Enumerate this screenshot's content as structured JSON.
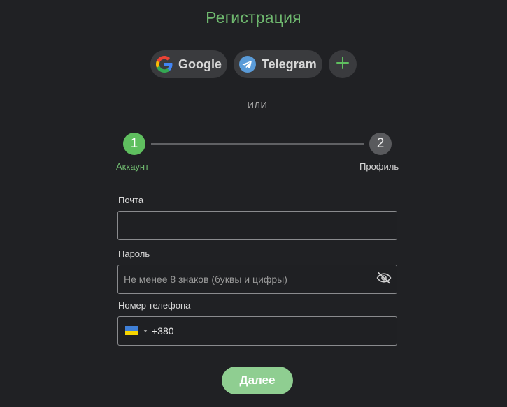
{
  "page": {
    "title": "Регистрация",
    "accent_color": "#6fb96f"
  },
  "social": {
    "google_label": "Google",
    "telegram_label": "Telegram",
    "google_icon": "google-logo-icon",
    "telegram_icon": "telegram-logo-icon",
    "more_icon": "plus-icon"
  },
  "divider": {
    "text": "ИЛИ"
  },
  "stepper": {
    "steps": [
      {
        "number": "1",
        "label": "Аккаунт",
        "active": true
      },
      {
        "number": "2",
        "label": "Профиль",
        "active": false
      }
    ]
  },
  "form": {
    "email": {
      "label": "Почта",
      "value": "",
      "placeholder": ""
    },
    "password": {
      "label": "Пароль",
      "value": "",
      "placeholder": "Не менее 8 знаков (буквы и цифры)",
      "toggle_icon": "eye-slash-icon"
    },
    "phone": {
      "label": "Номер телефона",
      "value": "+380",
      "country_flag": "ukraine-flag-icon"
    },
    "submit_label": "Далее"
  }
}
